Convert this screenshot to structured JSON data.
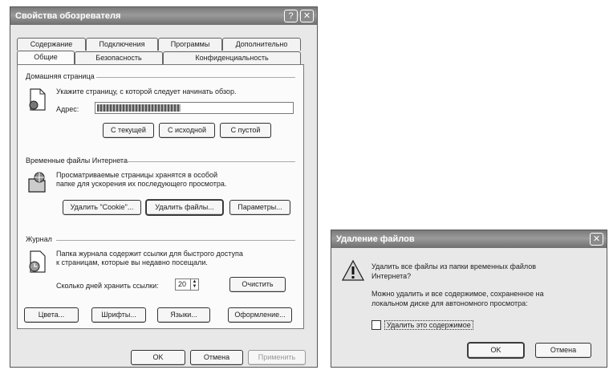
{
  "props": {
    "title": "Свойства обозревателя",
    "title_buttons": [
      "?",
      "✕"
    ],
    "tabs_row1": [
      "Содержание",
      "Подключения",
      "Программы",
      "Дополнительно"
    ],
    "tabs_row2": [
      "Общие",
      "Безопасность",
      "Конфиденциальность"
    ],
    "home": {
      "group_label": "Домашняя страница",
      "description": "Укажите страницу, с которой следует начинать обзор.",
      "address_label": "Адрес:",
      "address_value": "",
      "buttons": [
        "С текущей",
        "С исходной",
        "С пустой"
      ]
    },
    "temp": {
      "group_label": "Временные файлы Интернета",
      "description_line1": "Просматриваемые страницы хранятся в особой",
      "description_line2": "папке для ускорения их последующего просмотра.",
      "buttons": [
        "Удалить \"Cookie\"...",
        "Удалить файлы...",
        "Параметры..."
      ]
    },
    "history": {
      "group_label": "Журнал",
      "description_line1": "Папка журнала содержит ссылки для быстрого доступа",
      "description_line2": "к страницам, которые вы недавно посещали.",
      "days_label": "Сколько дней хранить ссылки:",
      "days_value": "20",
      "clear_button": "Очистить"
    },
    "bottom_buttons": [
      "Цвета...",
      "Шрифты...",
      "Языки...",
      "Оформление..."
    ],
    "dialog_buttons": [
      "OK",
      "Отмена",
      "Применить"
    ]
  },
  "delete_dialog": {
    "title": "Удаление файлов",
    "close_button": "✕",
    "question_line1": "Удалить все файлы из папки временных файлов",
    "question_line2": "Интернета?",
    "info_line1": "Можно удалить и все содержимое, сохраненное на",
    "info_line2": "локальном диске для автономного просмотра:",
    "checkbox_label": "Удалить это содержимое",
    "checkbox_checked": false,
    "buttons": [
      "OK",
      "Отмена"
    ]
  }
}
